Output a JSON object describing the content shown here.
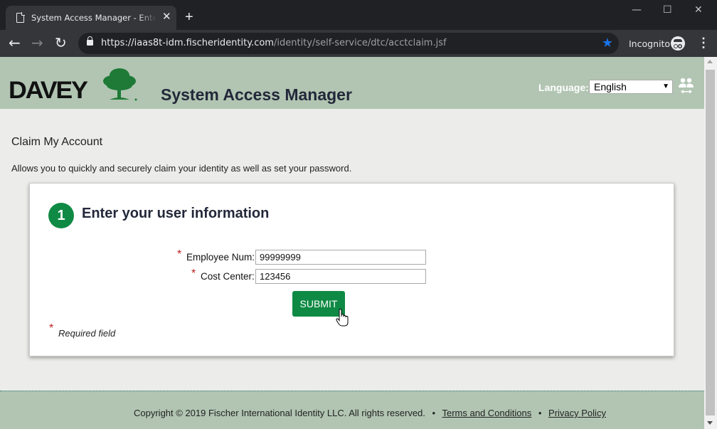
{
  "browser": {
    "tab_title": "System Access Manager - Enter your user information",
    "tab_close": "✕",
    "new_tab": "+",
    "url_host": "https://iaas8t-idm.fischeridentity.com",
    "url_path": "/identity/self-service/dtc/acctclaim.jsf",
    "incognito_label": "Incognito",
    "window_controls": {
      "minimize": "—",
      "maximize": "☐",
      "close": "✕"
    },
    "nav": {
      "back": "←",
      "forward": "→",
      "reload": "↻"
    },
    "bookmark_star": "★",
    "menu": "⋮"
  },
  "header": {
    "logo_text": "DAVEY",
    "app_title": "System Access Manager",
    "language_label": "Language:",
    "language_selected": "English",
    "language_arrow": "▼"
  },
  "page": {
    "title": "Claim My Account",
    "description": "Allows you to quickly and securely claim your identity as well as set your password."
  },
  "form": {
    "step_number": "1",
    "step_title": "Enter your user information",
    "required_marker": "*",
    "fields": [
      {
        "label": "Employee Num:",
        "value": "99999999"
      },
      {
        "label": "Cost Center:",
        "value": "123456"
      }
    ],
    "submit_label": "SUBMIT",
    "required_note": "Required field"
  },
  "footer": {
    "copyright": "Copyright © 2019 Fischer International Identity LLC. All rights reserved.",
    "separator": "•",
    "terms_link": "Terms and Conditions",
    "privacy_link": "Privacy Policy"
  },
  "colors": {
    "brand_green": "#0f8a44",
    "header_bg": "#b1c5b2",
    "page_bg": "#ececea",
    "bookmark_blue": "#1a73e8"
  }
}
